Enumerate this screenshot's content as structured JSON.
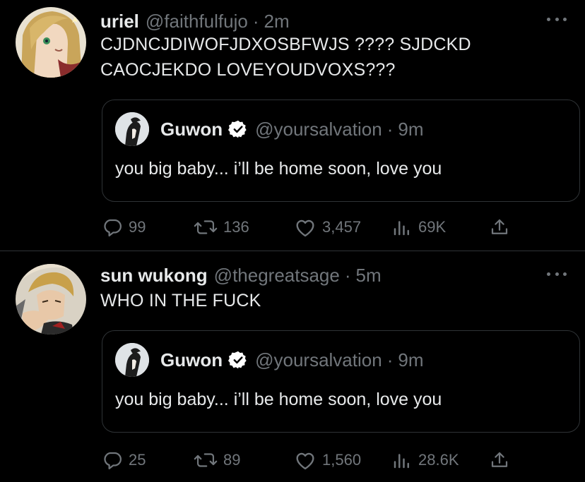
{
  "tweets": [
    {
      "name": "uriel",
      "handle": "@faithfulfujo",
      "time": "2m",
      "text_line1": "CJDNCJDIWOFJDXOSBFWJS ???? SJDCKD",
      "text_line2": "CAOCJEKDO LOVEYOUDVOXS???",
      "quote": {
        "name": "Guwon",
        "handle": "@yoursalvation",
        "time": "9m",
        "text": "you big baby... i’ll be home soon, love you"
      },
      "replies": "99",
      "retweets": "136",
      "likes": "3,457",
      "views": "69K"
    },
    {
      "name": "sun wukong",
      "handle": "@thegreatsage",
      "time": "5m",
      "text_line1": "WHO IN THE FUCK",
      "quote": {
        "name": "Guwon",
        "handle": "@yoursalvation",
        "time": "9m",
        "text": "you big baby... i’ll be home soon, love you"
      },
      "replies": "25",
      "retweets": "89",
      "likes": "1,560",
      "views": "28.6K"
    }
  ],
  "colors": {
    "background": "#000000",
    "text_primary": "#e7e9ea",
    "text_secondary": "#71767b",
    "border": "#2f3336",
    "verified": "#ffffff"
  },
  "icons": [
    "reply-icon",
    "retweet-icon",
    "like-icon",
    "views-icon",
    "share-icon",
    "more-icon",
    "verified-badge-icon"
  ]
}
